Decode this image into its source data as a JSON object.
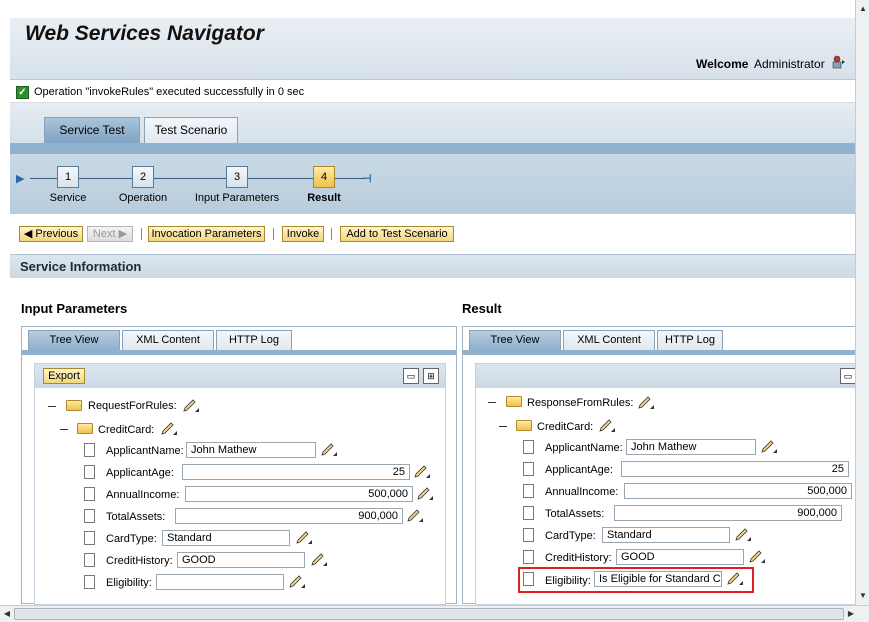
{
  "app": {
    "title": "Web Services Navigator",
    "welcome_label": "Welcome",
    "user": "Administrator",
    "logout_icon": "logout-icon"
  },
  "message": {
    "text": "Operation \"invokeRules\" executed successfully in 0 sec",
    "icon": "success-check-icon"
  },
  "tabs": [
    {
      "label": "Service Test",
      "active": true
    },
    {
      "label": "Test Scenario",
      "active": false
    }
  ],
  "roadmap": {
    "steps": [
      {
        "num": "1",
        "label": "Service"
      },
      {
        "num": "2",
        "label": "Operation"
      },
      {
        "num": "3",
        "label": "Input Parameters"
      },
      {
        "num": "4",
        "label": "Result",
        "active": true
      }
    ]
  },
  "toolbar": {
    "previous": "Previous",
    "next": "Next",
    "invocation_parameters": "Invocation Parameters",
    "invoke": "Invoke",
    "add_to_test_scenario": "Add to Test Scenario"
  },
  "service_info": "Service Information",
  "input": {
    "title": "Input Parameters",
    "tabs": [
      "Tree View",
      "XML Content",
      "HTTP Log"
    ],
    "export": "Export",
    "root": "RequestForRules:",
    "group": "CreditCard:",
    "fields": [
      {
        "label": "ApplicantName:",
        "value": "John Mathew"
      },
      {
        "label": "ApplicantAge:",
        "value": "25"
      },
      {
        "label": "AnnualIncome:",
        "value": "500,000"
      },
      {
        "label": "TotalAssets:",
        "value": "900,000"
      },
      {
        "label": "CardType:",
        "value": "Standard"
      },
      {
        "label": "CreditHistory:",
        "value": "GOOD"
      },
      {
        "label": "Eligibility:",
        "value": ""
      }
    ]
  },
  "result": {
    "title": "Result",
    "tabs": [
      "Tree View",
      "XML Content",
      "HTTP Log"
    ],
    "root": "ResponseFromRules:",
    "group": "CreditCard:",
    "fields": [
      {
        "label": "ApplicantName:",
        "value": "John Mathew"
      },
      {
        "label": "ApplicantAge:",
        "value": "25"
      },
      {
        "label": "AnnualIncome:",
        "value": "500,000"
      },
      {
        "label": "TotalAssets:",
        "value": "900,000"
      },
      {
        "label": "CardType:",
        "value": "Standard"
      },
      {
        "label": "CreditHistory:",
        "value": "GOOD"
      },
      {
        "label": "Eligibility:",
        "value": "Is Eligible for Standard Cre"
      }
    ]
  },
  "colors": {
    "highlight": "#e02020",
    "active_tab": "#7fa3c2",
    "button": "#f3d67a"
  }
}
